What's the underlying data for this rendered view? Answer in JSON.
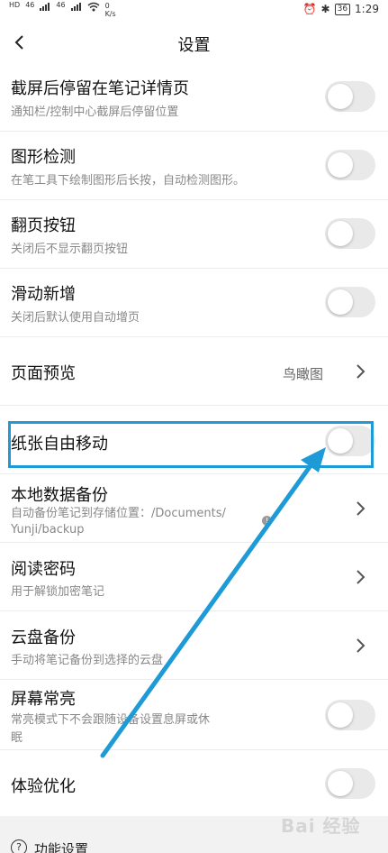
{
  "status_bar": {
    "sim_label": "HD",
    "signal_1": "46",
    "signal_2": "46",
    "speed": "0",
    "speed_unit": "K/s",
    "battery": "36",
    "time": "1:29"
  },
  "header": {
    "title": "设置"
  },
  "rows": [
    {
      "title": "截屏后停留在笔记详情页",
      "subtitle": "通知栏/控制中心截屏后停留位置"
    },
    {
      "title": "图形检测",
      "subtitle": "在笔工具下绘制图形后长按，自动检测图形。"
    },
    {
      "title": "翻页按钮",
      "subtitle": "关闭后不显示翻页按钮"
    },
    {
      "title": "滑动新增",
      "subtitle": "关闭后默认使用自动增页"
    },
    {
      "title": "页面预览",
      "value": "鸟瞰图"
    },
    {
      "title": "纸张自由移动"
    },
    {
      "title": "本地数据备份",
      "subtitle_line1": "自动备份笔记到存储位置：/Documents/",
      "subtitle_line2": "Yunji/backup"
    },
    {
      "title": "阅读密码",
      "subtitle": "用于解锁加密笔记"
    },
    {
      "title": "云盘备份",
      "subtitle": "手动将笔记备份到选择的云盘"
    },
    {
      "title": "屏幕常亮",
      "subtitle_line1": "常亮模式下不会跟随设备设置息屏或休",
      "subtitle_line2": "眠"
    },
    {
      "title": "体验优化"
    }
  ],
  "toggles": [
    false,
    false,
    false,
    false,
    false,
    false,
    false
  ],
  "footer": {
    "section_label": "功能设置"
  },
  "watermark": "Bai 经验",
  "colors": {
    "highlight": "#1e9bd6",
    "toggle_off": "#e9e9e9"
  }
}
